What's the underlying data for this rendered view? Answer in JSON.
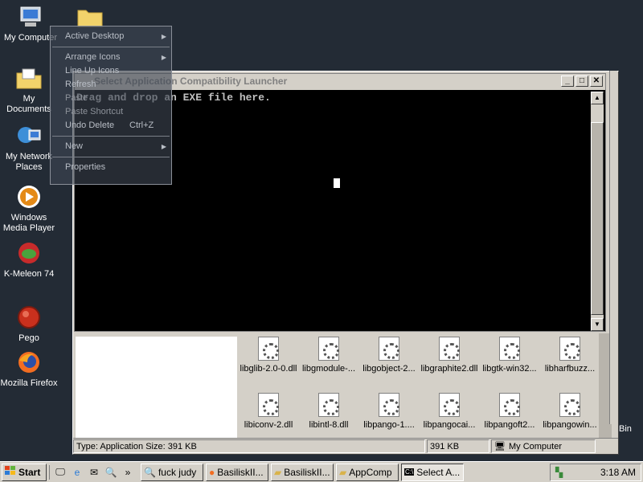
{
  "desktop": {
    "icons": [
      {
        "label": "My Computer",
        "icon": "computer-icon"
      },
      {
        "label": "My Documents",
        "icon": "documents-icon"
      },
      {
        "label": "My Network Places",
        "icon": "network-icon"
      },
      {
        "label": "Windows Media Player",
        "icon": "media-player-icon"
      },
      {
        "label": "K-Meleon 74",
        "icon": "kmeleon-icon"
      },
      {
        "label": "Pego",
        "icon": "pego-icon"
      },
      {
        "label": "Mozilla Firefox",
        "icon": "firefox-icon"
      }
    ],
    "bin_label": "Bin"
  },
  "context_menu": {
    "items": [
      {
        "label": "Active Desktop",
        "arrow": "▶"
      },
      {
        "label": "Arrange Icons",
        "arrow": "▶"
      },
      {
        "label": "Line Up Icons"
      },
      {
        "label": "Refresh"
      },
      {
        "label": "Paste"
      },
      {
        "label": "Paste Shortcut"
      },
      {
        "label": "Undo Delete",
        "shortcut": "Ctrl+Z"
      },
      {
        "label": "New",
        "arrow": "▶"
      },
      {
        "label": "Properties"
      }
    ]
  },
  "console": {
    "title": "Select Application Compatibility Launcher",
    "text": "Drag and drop an EXE file here.",
    "min": "_",
    "max": "□",
    "close": "✕"
  },
  "files": [
    {
      "name": "libglib-2.0-0.dll"
    },
    {
      "name": "libgmodule-..."
    },
    {
      "name": "libgobject-2..."
    },
    {
      "name": "libgraphite2.dll"
    },
    {
      "name": "libgtk-win32..."
    },
    {
      "name": "libharfbuzz..."
    },
    {
      "name": "libiconv-2.dll"
    },
    {
      "name": "libintl-8.dll"
    },
    {
      "name": "libpango-1...."
    },
    {
      "name": "libpangocai..."
    },
    {
      "name": "libpangoft2..."
    },
    {
      "name": "libpangowin..."
    }
  ],
  "status": {
    "type_text": "Type: Application Size: 391 KB",
    "size": "391 KB",
    "location": "My Computer"
  },
  "taskbar": {
    "start": "Start",
    "chevron": "»",
    "tasks": [
      {
        "label": "fuck judy"
      },
      {
        "label": "BasiliskII..."
      },
      {
        "label": "BasiliskII..."
      },
      {
        "label": "AppComp"
      },
      {
        "label": "Select A..."
      }
    ],
    "clock": "3:18 AM"
  }
}
